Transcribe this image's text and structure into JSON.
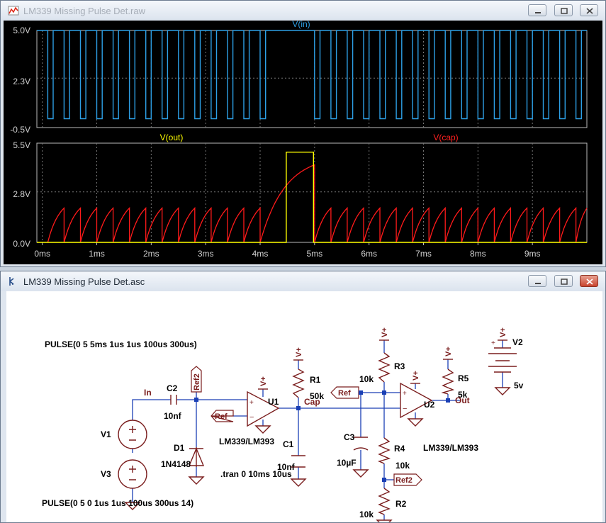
{
  "waveform_window": {
    "title": "LM339 Missing Pulse Det.raw",
    "top_pane": {
      "trace_label": "V(in)",
      "trace_color": "#2da0e6",
      "y_ticks": [
        "5.0V",
        "2.3V",
        "-0.5V"
      ]
    },
    "bottom_pane": {
      "trace_labels": [
        "V(out)",
        "V(cap)"
      ],
      "trace_colors": [
        "#ffff00",
        "#ff1a1a"
      ],
      "y_ticks": [
        "5.5V",
        "2.8V",
        "0.0V"
      ]
    },
    "x_ticks": [
      "0ms",
      "1ms",
      "2ms",
      "3ms",
      "4ms",
      "5ms",
      "6ms",
      "7ms",
      "8ms",
      "9ms"
    ]
  },
  "schematic_window": {
    "title": "LM339 Missing Pulse Det.asc",
    "wire_color": "#1a3fb5",
    "component_color": "#7a1d1d",
    "text_color": "#000000",
    "labels": {
      "pulse_v1": "PULSE(0 5 5ms 1us 1us 100us 300us)",
      "pulse_v3": "PULSE(0 5 0 1us 1us 100us 300us 14)",
      "tran": ".tran 0 10ms 10us",
      "v1": "V1",
      "v2": "V2",
      "v3": "V3",
      "v2_value": "5v",
      "c2": "C2",
      "c2_value": "10nf",
      "d1": "D1",
      "d1_value": "1N4148",
      "u1": "U1",
      "u1_model": "LM339/LM393",
      "u2": "U2",
      "u2_model": "LM339/LM393",
      "r1": "R1",
      "r1_value": "50k",
      "c1": "C1",
      "c1_value": "10nf",
      "r3": "R3",
      "r3_value": "10k",
      "r4": "R4",
      "r4_value": "10k",
      "r2": "R2",
      "r2_value": "10k",
      "r5": "R5",
      "r5_value": "5k",
      "c3": "C3",
      "c3_value": "10µF",
      "net_in": "In",
      "net_cap": "Cap",
      "net_out": "Out",
      "ref": "Ref",
      "ref2": "Ref2",
      "vplus": "V+",
      "plus": "+",
      "minus": "−"
    }
  },
  "chart_data": [
    {
      "type": "line",
      "title": "V(in)",
      "x_unit": "ms",
      "xlim": [
        -0.1,
        10.0
      ],
      "ylim": [
        -0.5,
        5.0
      ],
      "y_ticks": [
        5.0,
        2.3,
        -0.5
      ],
      "series": [
        {
          "name": "V(in)",
          "description": "Pulse train 0–5V, period 0.3ms, 0.1ms low pulse; high 0–0.1ms; pulses 0.1–4.1ms (14 pulses), missing pulses 4.1–5.0ms, pulses resume 5.0ms onward",
          "low": 0,
          "high": 5,
          "pulse_period_ms": 0.3,
          "pulse_low_ms": 0.1,
          "train1_start_ms": 0.1,
          "train1_count": 14,
          "train2_start_ms": 5.0
        }
      ]
    },
    {
      "type": "line",
      "x_unit": "ms",
      "xlim": [
        -0.1,
        10.0
      ],
      "ylim": [
        0.0,
        5.5
      ],
      "y_ticks": [
        5.5,
        2.8,
        0.0
      ],
      "series": [
        {
          "name": "V(out)",
          "points": [
            [
              -0.1,
              0
            ],
            [
              4.48,
              0
            ],
            [
              4.48,
              5.0
            ],
            [
              4.98,
              5.0
            ],
            [
              4.98,
              0
            ],
            [
              10.0,
              0
            ]
          ]
        },
        {
          "name": "V(cap)",
          "description": "Sawtooth ramps 0 to ~1.9V every 0.3ms; capacitor charges to ~4.3V during missing pulses (4.0–5.0ms), then sawtooth resumes",
          "sawtooth_peak_v": 1.9,
          "long_ramp_end_v": 4.3
        }
      ]
    }
  ]
}
